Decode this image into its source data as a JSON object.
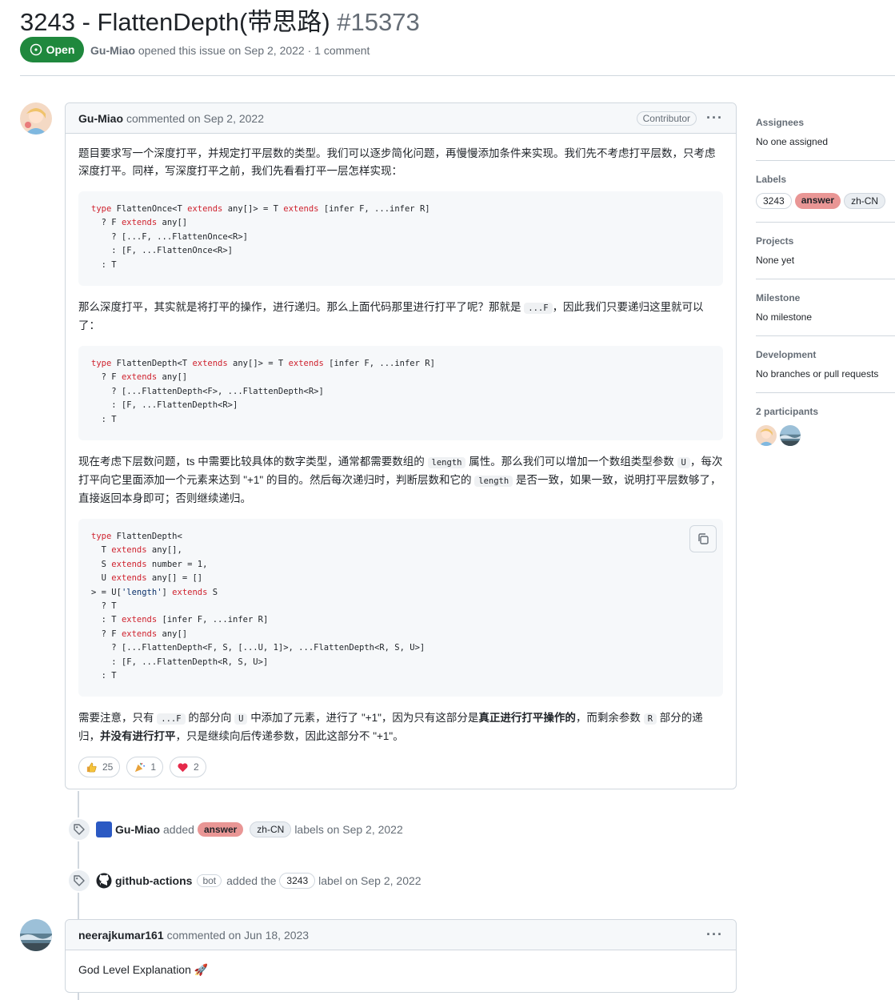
{
  "issue": {
    "title": "3243 - FlattenDepth(带思路)",
    "number": "#15373",
    "state": "Open",
    "author": "Gu-Miao",
    "meta_text": "opened this issue on Sep 2, 2022 · 1 comment"
  },
  "comment1": {
    "author": "Gu-Miao",
    "date_text": "commented on Sep 2, 2022",
    "role": "Contributor",
    "menu": "···",
    "p1": "题目要求写一个深度打平，并规定打平层数的类型。我们可以逐步简化问题，再慢慢添加条件来实现。我们先不考虑打平层数，只考虑深度打平。同样，写深度打平之前，我们先看看打平一层怎样实现：",
    "p2_a": "那么深度打平，其实就是将打平的操作，进行递归。那么上面代码那里进行打平了呢？那就是",
    "p2_code": "...F",
    "p2_b": "，因此我们只要递归这里就可以了：",
    "p3_a": "现在考虑下层数问题，ts 中需要比较具体的数字类型，通常都需要数组的",
    "p3_code1": "length",
    "p3_b": "属性。那么我们可以增加一个数组类型参数",
    "p3_code2": "U",
    "p3_c": "，每次打平向它里面添加一个元素来达到 \"+1\" 的目的。然后每次递归时，判断层数和它的",
    "p3_code3": "length",
    "p3_d": "是否一致，如果一致，说明打平层数够了，直接返回本身即可；否则继续递归。",
    "p4_a": "需要注意，只有",
    "p4_code1": "...F",
    "p4_b": "的部分向",
    "p4_code2": "U",
    "p4_c": "中添加了元素，进行了 \"+1\"，因为只有这部分是",
    "p4_bold1": "真正进行打平操作的",
    "p4_d": "，而剩余参数",
    "p4_code3": "R",
    "p4_e": "部分的递归，",
    "p4_bold2": "并没有进行打平",
    "p4_f": "，只是继续向后传递参数，因此这部分不 \"+1\"。",
    "reactions": [
      {
        "icon": "thumbs-up",
        "count": "25"
      },
      {
        "icon": "tada",
        "count": "1"
      },
      {
        "icon": "heart",
        "count": "2"
      }
    ]
  },
  "event1": {
    "actor": "Gu-Miao",
    "verb": "added",
    "labels": [
      "answer",
      "zh-CN"
    ],
    "suffix": "labels on Sep 2, 2022"
  },
  "event2": {
    "actor": "github-actions",
    "bot": "bot",
    "verb": "added the",
    "label": "3243",
    "suffix": "label on Sep 2, 2022"
  },
  "comment2": {
    "author": "neerajkumar161",
    "date_text": "commented on Jun 18, 2023",
    "menu": "···",
    "body": "God Level Explanation 🚀"
  },
  "sidebar": {
    "assignees_title": "Assignees",
    "assignees_value": "No one assigned",
    "labels_title": "Labels",
    "labels": [
      "3243",
      "answer",
      "zh-CN"
    ],
    "projects_title": "Projects",
    "projects_value": "None yet",
    "milestone_title": "Milestone",
    "milestone_value": "No milestone",
    "development_title": "Development",
    "development_value": "No branches or pull requests",
    "participants_title": "2 participants"
  },
  "colors": {
    "open_green": "#1f883d",
    "label_answer": "#e99695",
    "border": "#d0d7de",
    "muted": "#656d76"
  }
}
